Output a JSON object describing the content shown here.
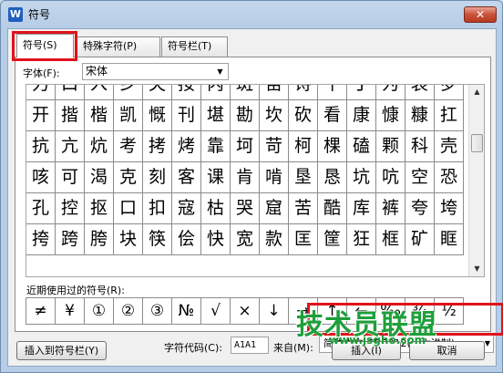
{
  "window": {
    "title": "符号",
    "app_icon": "W",
    "close_label": "✕"
  },
  "tabs": [
    {
      "label": "符号(S)",
      "active": true
    },
    {
      "label": "特殊字符(P)",
      "active": false
    },
    {
      "label": "符号栏(T)",
      "active": false
    }
  ],
  "font": {
    "label": "字体(F):",
    "value": "宋体"
  },
  "symbol_grid": {
    "rows": [
      [
        "力",
        "口",
        "入",
        "乡",
        "失",
        "按",
        "丙",
        "斑",
        "苗",
        "诗",
        "牛",
        "丁",
        "为",
        "哀",
        "罗"
      ],
      [
        "开",
        "揩",
        "楷",
        "凯",
        "慨",
        "刊",
        "堪",
        "勘",
        "坎",
        "砍",
        "看",
        "康",
        "慷",
        "糠",
        "扛"
      ],
      [
        "抗",
        "亢",
        "炕",
        "考",
        "拷",
        "烤",
        "靠",
        "坷",
        "苛",
        "柯",
        "棵",
        "磕",
        "颗",
        "科",
        "壳"
      ],
      [
        "咳",
        "可",
        "渴",
        "克",
        "刻",
        "客",
        "课",
        "肯",
        "啃",
        "垦",
        "恳",
        "坑",
        "吭",
        "空",
        "恐"
      ],
      [
        "孔",
        "控",
        "抠",
        "口",
        "扣",
        "寇",
        "枯",
        "哭",
        "窟",
        "苦",
        "酷",
        "库",
        "裤",
        "夸",
        "垮"
      ],
      [
        "挎",
        "跨",
        "胯",
        "块",
        "筷",
        "侩",
        "快",
        "宽",
        "款",
        "匡",
        "筐",
        "狂",
        "框",
        "矿",
        "眶"
      ]
    ]
  },
  "recent": {
    "label": "近期使用过的符号(R):",
    "symbols": [
      "≠",
      "¥",
      "①",
      "②",
      "③",
      "№",
      "√",
      "×",
      "↓",
      "→",
      "↑",
      "←",
      "‰",
      "¾",
      "½"
    ]
  },
  "char_code": {
    "label": "字符代码(C):",
    "value": "A1A1"
  },
  "from": {
    "label": "来自(M):",
    "value": "简体中文 GB2312(十六进制)"
  },
  "buttons": {
    "insert_to_bar": "插入到符号栏(Y)",
    "insert": "插入(I)",
    "cancel": "取消"
  },
  "watermark": {
    "text": "技术员联盟",
    "url": "www.jsgho.com"
  },
  "colors": {
    "highlight": "#e0121b",
    "watermark": "#1e9f3a"
  }
}
